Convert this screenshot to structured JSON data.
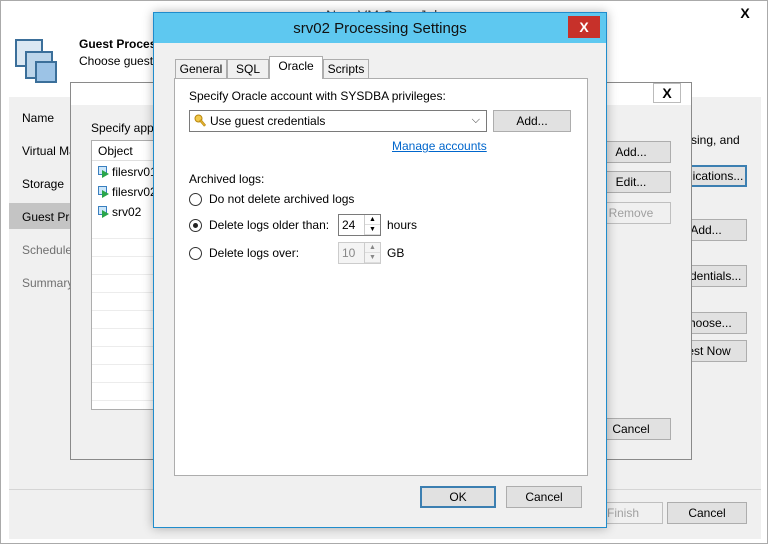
{
  "wizard": {
    "title": "New VM Copy Job",
    "header_title": "Guest Processing",
    "header_subtitle": "Choose guest OS processing options available for running VMs.",
    "nav": [
      "Name",
      "Virtual Machines",
      "Storage",
      "Guest Processing",
      "Schedule",
      "Summary"
    ],
    "right_text": "sing, and",
    "buttons": {
      "applications": "Applications...",
      "add": "Add...",
      "credentials": "Credentials...",
      "choose": "Choose...",
      "test_now": "Test Now",
      "finish": "Finish",
      "cancel": "Cancel"
    },
    "close": "X"
  },
  "mid": {
    "prompt": "Specify application-aware processing settings for individual VMs:",
    "list_header": "Object",
    "objects": [
      "filesrv01",
      "filesrv02",
      "srv02"
    ],
    "buttons": {
      "add": "Add...",
      "edit": "Edit...",
      "remove": "Remove",
      "cancel": "Cancel"
    },
    "close": "X"
  },
  "dialog": {
    "title": "srv02 Processing Settings",
    "close": "X",
    "tabs": [
      "General",
      "SQL",
      "Oracle",
      "Scripts"
    ],
    "active_tab": "Oracle",
    "oracle": {
      "account_label": "Specify Oracle account with SYSDBA privileges:",
      "account_value": "Use guest credentials",
      "add_button": "Add...",
      "manage_link": "Manage accounts",
      "archived_label": "Archived logs:",
      "opt_none": "Do not delete archived logs",
      "opt_older": "Delete logs older than:",
      "older_value": "24",
      "older_unit": "hours",
      "opt_over": "Delete logs over:",
      "over_value": "10",
      "over_unit": "GB",
      "selected": "older"
    },
    "ok": "OK",
    "cancel": "Cancel"
  }
}
